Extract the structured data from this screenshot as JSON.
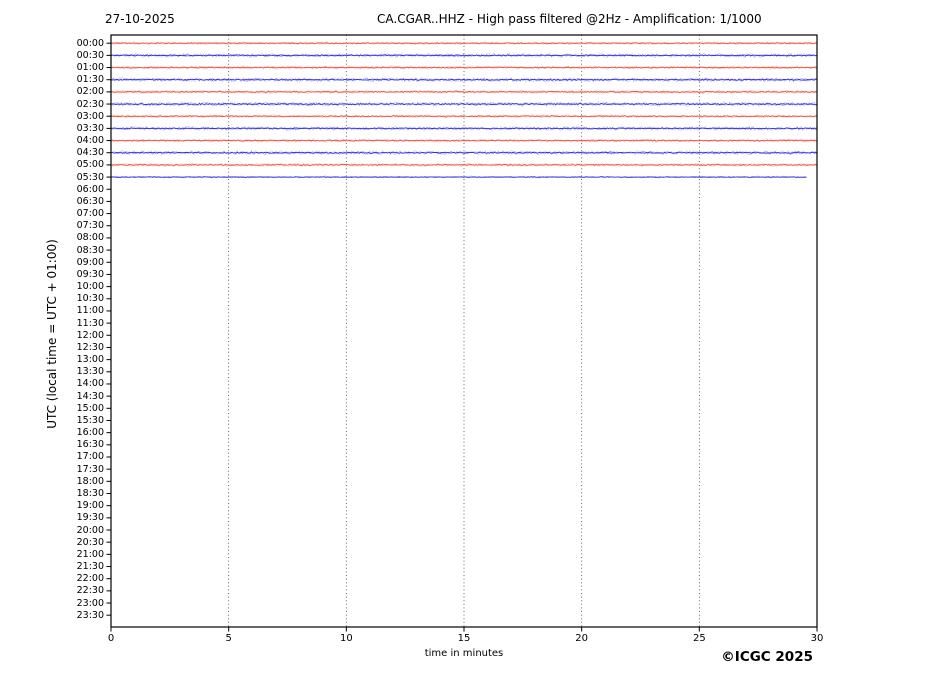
{
  "header": {
    "date": "27-10-2025",
    "title": "CA.CGAR..HHZ - High pass filtered @2Hz - Amplification: 1/1000"
  },
  "footer": {
    "copyright": "©ICGC 2025"
  },
  "axes": {
    "y_label": "UTC (local time = UTC + 01:00)",
    "x_label": "time in minutes",
    "x_tick_labels": [
      "0",
      "5",
      "10",
      "15",
      "20",
      "25",
      "30"
    ],
    "row_labels": [
      "00:00",
      "00:30",
      "01:00",
      "01:30",
      "02:00",
      "02:30",
      "03:00",
      "03:30",
      "04:00",
      "04:30",
      "05:00",
      "05:30",
      "06:00",
      "06:30",
      "07:00",
      "07:30",
      "08:00",
      "08:30",
      "09:00",
      "09:30",
      "10:00",
      "10:30",
      "11:00",
      "11:30",
      "12:00",
      "12:30",
      "13:00",
      "13:30",
      "14:00",
      "14:30",
      "15:00",
      "15:30",
      "16:00",
      "16:30",
      "17:00",
      "17:30",
      "18:00",
      "18:30",
      "19:00",
      "19:30",
      "20:00",
      "20:30",
      "21:00",
      "21:30",
      "22:00",
      "22:30",
      "23:00",
      "23:30"
    ]
  },
  "colors": {
    "trace_red": "#ee4433",
    "trace_blue": "#2020e0",
    "gridline": "#444444",
    "axis": "#000000"
  },
  "chart_data": {
    "type": "line",
    "subtype": "helicorder-seismogram",
    "title": "CA.CGAR..HHZ - High pass filtered @2Hz - Amplification: 1/1000",
    "date": "27-10-2025",
    "xlabel": "time in minutes",
    "ylabel": "UTC (local time = UTC + 01:00)",
    "xlim": [
      0,
      30
    ],
    "x_ticks": [
      0,
      5,
      10,
      15,
      20,
      25,
      30
    ],
    "grid": "vertical dotted gridlines every 5 minutes",
    "row_interval_minutes": 30,
    "rows_total": 48,
    "legend": "none",
    "traces": [
      {
        "time": "00:00",
        "color": "red",
        "start_min": 0,
        "end_min": 30,
        "amp": 1.0,
        "character": "flat background noise"
      },
      {
        "time": "00:30",
        "color": "blue",
        "start_min": 0,
        "end_min": 30,
        "amp": 1.3,
        "character": "flat background noise"
      },
      {
        "time": "01:00",
        "color": "red",
        "start_min": 0,
        "end_min": 30,
        "amp": 1.15,
        "character": "flat background noise"
      },
      {
        "time": "01:30",
        "color": "blue",
        "start_min": 0,
        "end_min": 30,
        "amp": 1.4,
        "character": "flat background noise"
      },
      {
        "time": "02:00",
        "color": "red",
        "start_min": 0,
        "end_min": 30,
        "amp": 1.2,
        "character": "flat background noise"
      },
      {
        "time": "02:30",
        "color": "blue",
        "start_min": 0,
        "end_min": 30,
        "amp": 1.4,
        "character": "flat background noise"
      },
      {
        "time": "03:00",
        "color": "red",
        "start_min": 0,
        "end_min": 30,
        "amp": 1.1,
        "character": "flat background noise"
      },
      {
        "time": "03:30",
        "color": "blue",
        "start_min": 0,
        "end_min": 30,
        "amp": 1.3,
        "character": "flat background noise"
      },
      {
        "time": "04:00",
        "color": "red",
        "start_min": 0,
        "end_min": 30,
        "amp": 1.2,
        "character": "flat background noise"
      },
      {
        "time": "04:30",
        "color": "blue",
        "start_min": 0,
        "end_min": 30,
        "amp": 1.35,
        "character": "flat background noise"
      },
      {
        "time": "05:00",
        "color": "red",
        "start_min": 0,
        "end_min": 30,
        "amp": 1.15,
        "character": "flat background noise"
      },
      {
        "time": "05:30",
        "color": "blue",
        "start_min": 0,
        "end_min": 29.6,
        "amp": 0.7,
        "character": "flat background noise, recording stops before end of line"
      }
    ],
    "empty_rows": [
      "06:00",
      "06:30",
      "07:00",
      "07:30",
      "08:00",
      "08:30",
      "09:00",
      "09:30",
      "10:00",
      "10:30",
      "11:00",
      "11:30",
      "12:00",
      "12:30",
      "13:00",
      "13:30",
      "14:00",
      "14:30",
      "15:00",
      "15:30",
      "16:00",
      "16:30",
      "17:00",
      "17:30",
      "18:00",
      "18:30",
      "19:00",
      "19:30",
      "20:00",
      "20:30",
      "21:00",
      "21:30",
      "22:00",
      "22:30",
      "23:00",
      "23:30"
    ]
  }
}
